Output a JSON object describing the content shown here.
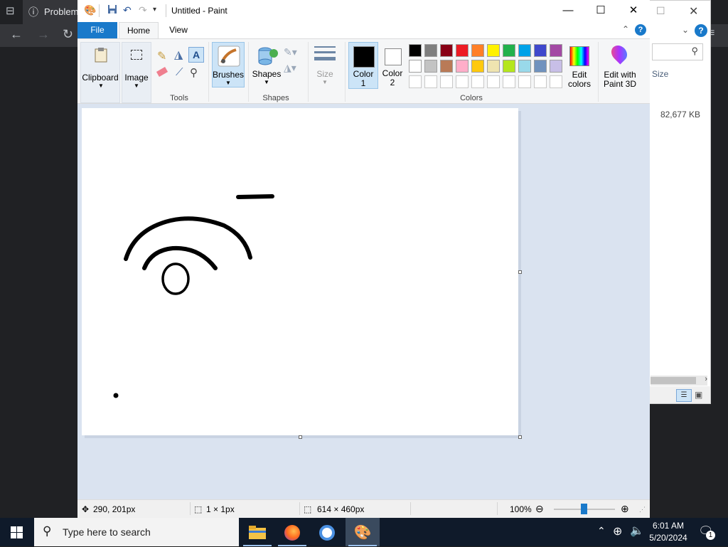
{
  "browser": {
    "tab_label": "Problem"
  },
  "explorer": {
    "size_header": "Size",
    "file_size": "82,677 KB"
  },
  "paint": {
    "title": "Untitled - Paint",
    "tabs": {
      "file": "File",
      "home": "Home",
      "view": "View"
    },
    "groups": {
      "clipboard": "Clipboard",
      "image": "Image",
      "tools": "Tools",
      "brushes": "Brushes",
      "shapes_btn": "Shapes",
      "shapes": "Shapes",
      "size": "Size",
      "color1": "Color\n1",
      "color2": "Color\n2",
      "colors": "Colors",
      "edit_colors": "Edit\ncolors",
      "edit_paint3d": "Edit with\nPaint 3D"
    },
    "palette_row1": [
      "#000000",
      "#7f7f7f",
      "#880015",
      "#ed1c24",
      "#ff7f27",
      "#fff200",
      "#22b14c",
      "#00a2e8",
      "#3f48cc",
      "#a349a4"
    ],
    "palette_row2": [
      "#ffffff",
      "#c3c3c3",
      "#b97a57",
      "#ffaec9",
      "#ffc90e",
      "#efe4b0",
      "#b5e61d",
      "#99d9ea",
      "#7092be",
      "#c8bfe7"
    ],
    "color1": "#000000",
    "color2": "#ffffff",
    "status": {
      "cursor_pos": "290, 201px",
      "selection_size": "1 × 1px",
      "canvas_size": "614 × 460px",
      "zoom": "100%"
    }
  },
  "taskbar": {
    "search_placeholder": "Type here to search",
    "time": "6:01 AM",
    "date": "5/20/2024",
    "notification_count": "1"
  }
}
